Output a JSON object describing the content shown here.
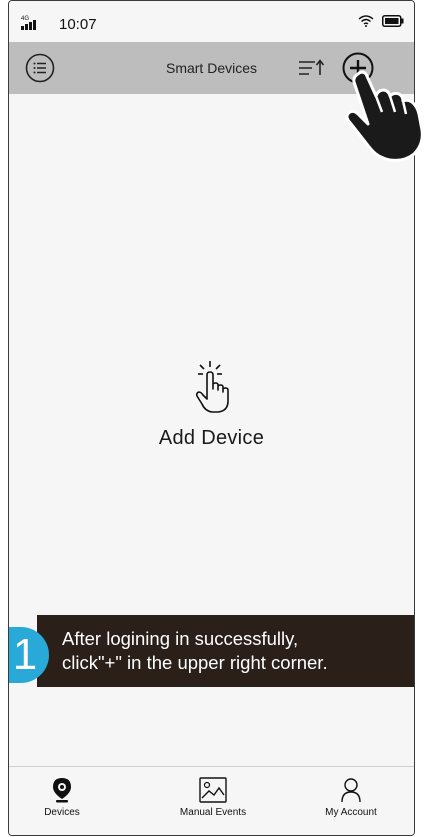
{
  "status_bar": {
    "network": "4G",
    "time": "10:07"
  },
  "header": {
    "title": "Smart Devices",
    "menu_icon": "menu-list-icon",
    "sort_icon": "sort-icon",
    "add_icon": "plus-circle-icon"
  },
  "empty_state": {
    "label": "Add Device",
    "icon": "tap-hand-icon"
  },
  "tabs": [
    {
      "label": "Devices",
      "icon": "camera-pin-icon",
      "active": true
    },
    {
      "label": "Manual Events",
      "icon": "image-icon",
      "active": false
    },
    {
      "label": "My Account",
      "icon": "person-icon",
      "active": false
    }
  ],
  "instruction": {
    "step": "1",
    "line1": "After logining in successfully,",
    "line2": "click\"+\" in the upper right corner."
  },
  "colors": {
    "header_bg": "#bdbdbd",
    "step_badge": "#29a9d8",
    "tip_bg": "#2b1f1a"
  }
}
